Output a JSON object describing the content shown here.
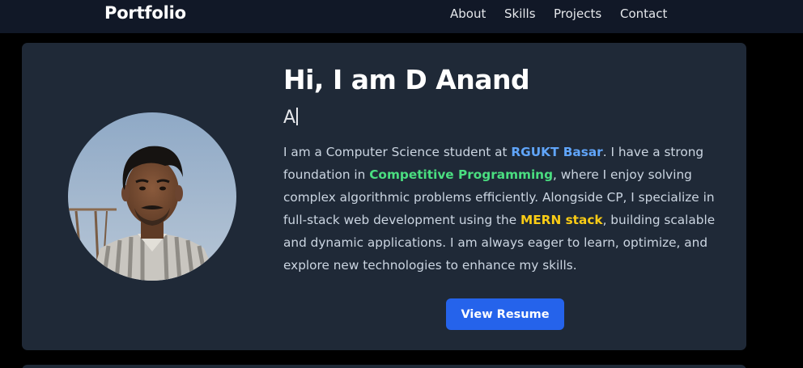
{
  "navbar": {
    "brand": "Portfolio",
    "links": [
      "About",
      "Skills",
      "Projects",
      "Contact"
    ]
  },
  "hero": {
    "greeting": "Hi, I am D Anand",
    "typing_text": "A",
    "bio": {
      "p1": "I am a Computer Science student at ",
      "h1": "RGUKT Basar",
      "p2": ". I have a strong foundation in ",
      "h2": "Competitive Programming",
      "p3": ", where I enjoy solving complex algorithmic problems efficiently. Alongside CP, I specialize in full-stack web development using the ",
      "h3": "MERN stack",
      "p4": ", building scalable and dynamic applications. I am always eager to learn, optimize, and explore new technologies to enhance my skills."
    },
    "resume_button": "View Resume"
  },
  "colors": {
    "page_bg": "#000000",
    "navbar_bg": "#111827",
    "card_bg": "#1f2937",
    "accent_blue": "#60a5fa",
    "accent_green": "#4ade80",
    "accent_yellow": "#facc15",
    "button_bg": "#2563eb"
  }
}
